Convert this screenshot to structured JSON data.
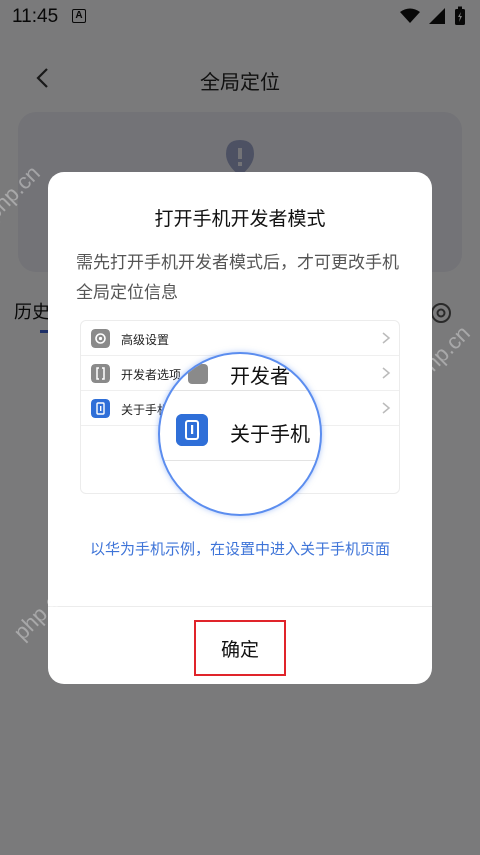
{
  "status_bar": {
    "time": "11:45",
    "notification_icon": "A"
  },
  "header": {
    "title": "全局定位"
  },
  "background": {
    "history_label": "历史"
  },
  "dialog": {
    "title": "打开手机开发者模式",
    "description": "需先打开手机开发者模式后，才可更改手机全局定位信息",
    "illustration": {
      "rows": [
        {
          "label": "高级设置",
          "icon": "gear-icon"
        },
        {
          "label": "开发者选项",
          "icon": "braces-icon"
        },
        {
          "label": "关于手机",
          "icon": "info-icon"
        }
      ],
      "magnifier": {
        "top_label": "开发者",
        "label": "关于手机"
      }
    },
    "carousel": {
      "page_count": 2,
      "active_index": 0
    },
    "hint": "以华为手机示例，在设置中进入关于手机页面",
    "confirm_label": "确定"
  },
  "watermarks": [
    "php.cn",
    "php.cn",
    "php.cn"
  ],
  "colors": {
    "accent": "#3e74d8",
    "highlight_border": "#e0242a",
    "info_icon": "#2f6fd8"
  }
}
